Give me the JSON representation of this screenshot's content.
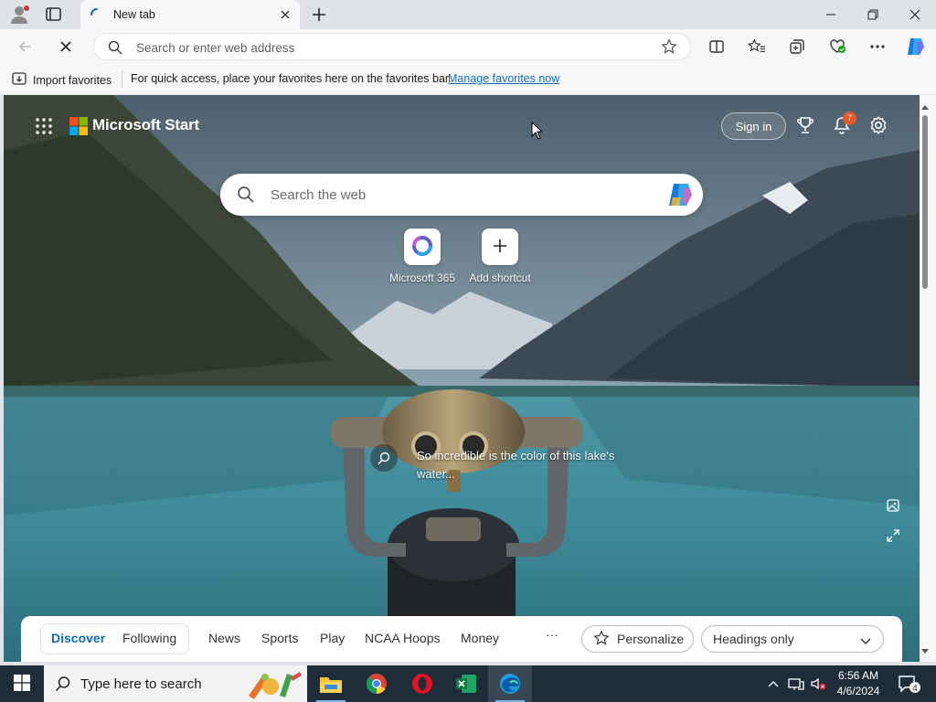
{
  "browser": {
    "tab_title": "New tab",
    "address_placeholder": "Search or enter web address"
  },
  "favorites_bar": {
    "import_label": "Import favorites",
    "message": "For quick access, place your favorites here on the favorites bar.",
    "link": "Manage favorites now"
  },
  "start_page": {
    "brand": "Microsoft Start",
    "sign_in": "Sign in",
    "notification_count": "7",
    "search_placeholder": "Search the web",
    "shortcuts": [
      {
        "label": "Microsoft 365",
        "icon": "microsoft-365-icon"
      },
      {
        "label": "Add shortcut",
        "icon": "plus-icon"
      }
    ],
    "image_caption": "So incredible is the color of this lake's water...",
    "feed": {
      "tabs": [
        "Discover",
        "Following"
      ],
      "active_tab": "Discover",
      "categories": [
        "News",
        "Sports",
        "Play",
        "NCAA Hoops",
        "Money"
      ],
      "more": "···",
      "personalize": "Personalize",
      "layout_select": "Headings only"
    }
  },
  "taskbar": {
    "search_placeholder": "Type here to search",
    "time": "6:56 AM",
    "date": "4/6/2024",
    "notification_count": "4",
    "apps": [
      "file-explorer-icon",
      "chrome-icon",
      "opera-icon",
      "excel-icon",
      "edge-icon"
    ]
  },
  "colors": {
    "accent_blue": "#0f6cbd",
    "badge_orange": "#e05a2a",
    "taskbar_bg": "#1f2d3a",
    "lake_teal": "#3f8b99"
  }
}
